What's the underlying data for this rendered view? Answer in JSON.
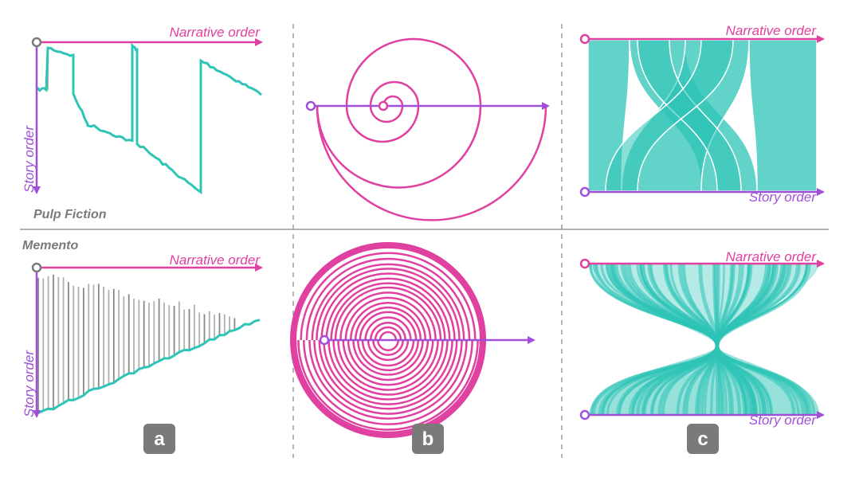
{
  "labels": {
    "narrative_order": "Narrative order",
    "story_order": "Story order",
    "film_top": "Pulp Fiction",
    "film_bottom": "Memento",
    "badge_a": "a",
    "badge_b": "b",
    "badge_c": "c"
  },
  "colors": {
    "narrative_axis": "#e040a0",
    "story_axis": "#a050d8",
    "teal": "#2ec4b6",
    "spiral": "#e040a0",
    "jump": "#b0b0b0",
    "badge": "#7a7a7a",
    "divider": "#9a9a9a"
  }
}
